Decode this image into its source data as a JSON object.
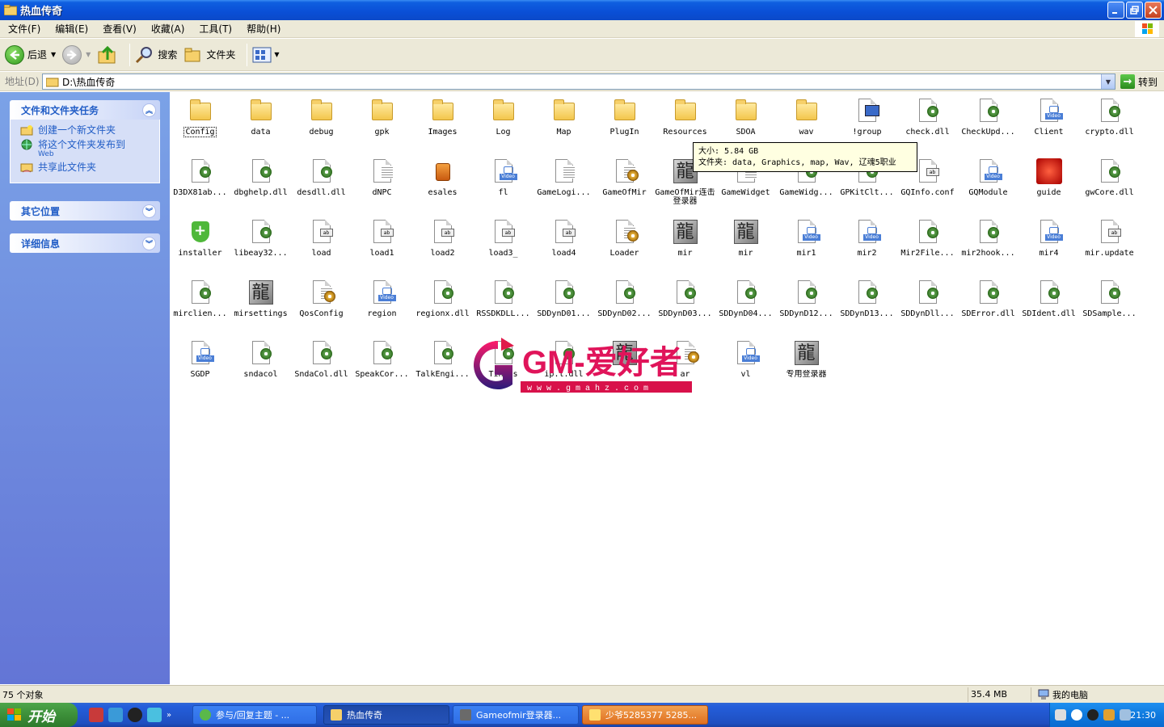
{
  "window": {
    "title": "热血传奇"
  },
  "menu": [
    "文件(F)",
    "编辑(E)",
    "查看(V)",
    "收藏(A)",
    "工具(T)",
    "帮助(H)"
  ],
  "toolbar": {
    "back": "后退",
    "search": "搜索",
    "folders": "文件夹"
  },
  "address": {
    "label": "地址(D)",
    "value": "D:\\热血传奇",
    "go": "转到"
  },
  "taskpane": {
    "tasks_title": "文件和文件夹任务",
    "tasks": [
      {
        "label": "创建一个新文件夹",
        "sub": ""
      },
      {
        "label": "将这个文件夹发布到",
        "sub": "Web"
      },
      {
        "label": "共享此文件夹",
        "sub": ""
      }
    ],
    "other_title": "其它位置",
    "details_title": "详细信息"
  },
  "files": [
    {
      "name": "Config",
      "icon": "folder"
    },
    {
      "name": "data",
      "icon": "folder"
    },
    {
      "name": "debug",
      "icon": "folder"
    },
    {
      "name": "gpk",
      "icon": "folder"
    },
    {
      "name": "Images",
      "icon": "folder"
    },
    {
      "name": "Log",
      "icon": "folder"
    },
    {
      "name": "Map",
      "icon": "folder"
    },
    {
      "name": "PlugIn",
      "icon": "folder"
    },
    {
      "name": "Resources",
      "icon": "folder"
    },
    {
      "name": "SDOA",
      "icon": "folder"
    },
    {
      "name": "wav",
      "icon": "folder"
    },
    {
      "name": "!group",
      "icon": "network"
    },
    {
      "name": "check.dll",
      "icon": "dll"
    },
    {
      "name": "CheckUpd...",
      "icon": "dll"
    },
    {
      "name": "Client",
      "icon": "video"
    },
    {
      "name": "crypto.dll",
      "icon": "dll"
    },
    {
      "name": "D3DX81ab...",
      "icon": "dll"
    },
    {
      "name": "dbghelp.dll",
      "icon": "dll"
    },
    {
      "name": "desdll.dll",
      "icon": "dll"
    },
    {
      "name": "dNPC",
      "icon": "text"
    },
    {
      "name": "esales",
      "icon": "jar"
    },
    {
      "name": "fl",
      "icon": "video"
    },
    {
      "name": "GameLogi...",
      "icon": "text"
    },
    {
      "name": "GameOfMir",
      "icon": "config"
    },
    {
      "name": "GameOfMir连击登录器",
      "icon": "dragon"
    },
    {
      "name": "GameWidget",
      "icon": "text"
    },
    {
      "name": "GameWidg...",
      "icon": "dll"
    },
    {
      "name": "GPKitClt...",
      "icon": "dll"
    },
    {
      "name": "GQInfo.conf",
      "icon": "ini"
    },
    {
      "name": "GQModule",
      "icon": "video"
    },
    {
      "name": "guide",
      "icon": "red"
    },
    {
      "name": "gwCore.dll",
      "icon": "dll"
    },
    {
      "name": "installer",
      "icon": "shield"
    },
    {
      "name": "libeay32...",
      "icon": "dll"
    },
    {
      "name": "load",
      "icon": "ini"
    },
    {
      "name": "load1",
      "icon": "ini"
    },
    {
      "name": "load2",
      "icon": "ini"
    },
    {
      "name": "load3_",
      "icon": "ini"
    },
    {
      "name": "load4",
      "icon": "ini"
    },
    {
      "name": "Loader",
      "icon": "config"
    },
    {
      "name": "mir",
      "icon": "dragon"
    },
    {
      "name": "mir",
      "icon": "dragon"
    },
    {
      "name": "mir1",
      "icon": "video"
    },
    {
      "name": "mir2",
      "icon": "video"
    },
    {
      "name": "Mir2File...",
      "icon": "dll"
    },
    {
      "name": "mir2hook...",
      "icon": "dll"
    },
    {
      "name": "mir4",
      "icon": "video"
    },
    {
      "name": "mir.update",
      "icon": "ini"
    },
    {
      "name": "mirclien...",
      "icon": "dll"
    },
    {
      "name": "mirsettings",
      "icon": "dragon"
    },
    {
      "name": "QosConfig",
      "icon": "config"
    },
    {
      "name": "region",
      "icon": "video"
    },
    {
      "name": "regionx.dll",
      "icon": "dll"
    },
    {
      "name": "RSSDKDLL...",
      "icon": "dll"
    },
    {
      "name": "SDDynD01...",
      "icon": "dll"
    },
    {
      "name": "SDDynD02...",
      "icon": "dll"
    },
    {
      "name": "SDDynD03...",
      "icon": "dll"
    },
    {
      "name": "SDDynD04...",
      "icon": "dll"
    },
    {
      "name": "SDDynD12...",
      "icon": "dll"
    },
    {
      "name": "SDDynD13...",
      "icon": "dll"
    },
    {
      "name": "SDDynDll...",
      "icon": "dll"
    },
    {
      "name": "SDError.dll",
      "icon": "dll"
    },
    {
      "name": "SDIdent.dll",
      "icon": "dll"
    },
    {
      "name": "SDSample...",
      "icon": "dll"
    },
    {
      "name": "SGDP",
      "icon": "video"
    },
    {
      "name": "sndacol",
      "icon": "dll"
    },
    {
      "name": "SndaCol.dll",
      "icon": "dll"
    },
    {
      "name": "SpeakCor...",
      "icon": "dll"
    },
    {
      "name": "TalkEngi...",
      "icon": "dll"
    },
    {
      "name": "Tinues",
      "icon": "dll"
    },
    {
      "name": "ip.l.dll",
      "icon": "dll"
    },
    {
      "name": "",
      "icon": "dragon"
    },
    {
      "name": "ar",
      "icon": "config"
    },
    {
      "name": "vl",
      "icon": "video"
    },
    {
      "name": "专用登录器",
      "icon": "dragon"
    }
  ],
  "tooltip": {
    "line1": "大小: 5.84 GB",
    "line2": "文件夹: data, Graphics, map, Wav, 辽魂5职业"
  },
  "watermark": {
    "brand": "GM-爱好者",
    "url": "w w w . g m a h z . c o m"
  },
  "status": {
    "count": "75 个对象",
    "size": "35.4 MB",
    "location": "我的电脑"
  },
  "taskbar": {
    "start": "开始",
    "buttons": [
      "参与/回复主题 - ...",
      "热血传奇",
      "Gameofmir登录器...",
      "少爷5285377 5285..."
    ],
    "clock": "21:30"
  }
}
